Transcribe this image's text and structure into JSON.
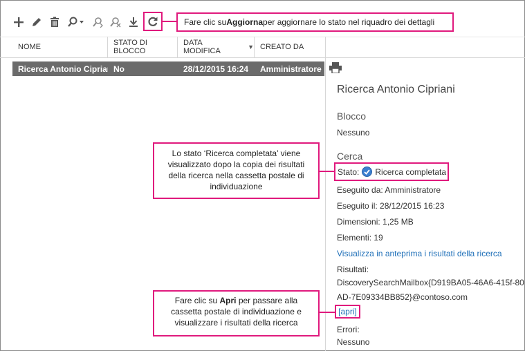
{
  "toolbar": {
    "icons": [
      "add-icon",
      "edit-icon",
      "delete-icon",
      "search-icon",
      "dropdown-icon",
      "estimate-icon",
      "stop-icon",
      "export-icon",
      "refresh-icon"
    ]
  },
  "callouts": {
    "refresh_pre": "Fare clic su ",
    "refresh_bold": "Aggiorna",
    "refresh_post": " per aggiornare lo stato nel riquadro dei dettagli",
    "status_note": "Lo stato ‘Ricerca completata’ viene visualizzato dopo la copia dei risultati della ricerca nella cassetta postale di individuazione",
    "open_pre": "Fare clic su ",
    "open_bold": "Apri",
    "open_post": " per passare alla cassetta postale di individuazione e visualizzare i risultati della ricerca"
  },
  "table": {
    "columns": [
      "NOME",
      "STATO DI BLOCCO",
      "DATA MODIFICA",
      "CREATO DA"
    ],
    "rows": [
      {
        "name": "Ricerca Antonio Cipriani",
        "hold": "No",
        "modified": "28/12/2015 16:24",
        "created_by": "Amministratore"
      }
    ]
  },
  "details": {
    "title": "Ricerca Antonio Cipriani",
    "hold_section": "Blocco",
    "hold_value": "Nessuno",
    "search_section": "Cerca",
    "status_label": "Stato:",
    "status_value": "Ricerca completata",
    "run_by": "Eseguito da: Amministratore",
    "run_on": "Eseguito il: 28/12/2015 16:23",
    "size": "Dimensioni: 1,25 MB",
    "items": "Elementi: 19",
    "preview_link": "Visualizza in anteprima i risultati della ricerca",
    "results_label": "Risultati:",
    "results_line1": "DiscoverySearchMailbox{D919BA05-46A6-415f-80",
    "results_line2": "AD-7E09334BB852}@contoso.com",
    "open_link": "[apri]",
    "errors_label": "Errori:",
    "errors_value": "Nessuno"
  },
  "colors": {
    "accent": "#e0197d",
    "selected_row": "#6b6b6b",
    "link": "#1e6fb8"
  }
}
